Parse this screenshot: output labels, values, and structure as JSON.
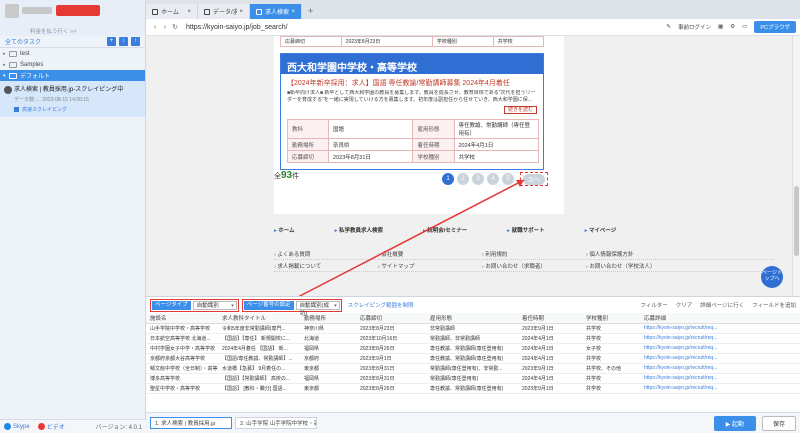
{
  "sidebar": {
    "promo": "料金を払う行く >>",
    "toolbar_title": "全てのタスク",
    "tree": [
      {
        "label": "test",
        "active": false
      },
      {
        "label": "Samples",
        "active": false
      },
      {
        "label": "デフォルト",
        "active": true
      }
    ],
    "task": {
      "title": "求人検索 | 教員採用.jp-スクレイピング中",
      "meta": "データ数: ... 2023-08-15 14:00:15",
      "status": "高速スクレイピング"
    },
    "footer": {
      "skype": "Skype",
      "video": "ビデオ",
      "version": "バージョン: 4.0.1"
    }
  },
  "browser": {
    "tabs": [
      {
        "label": "ホーム",
        "active": false
      },
      {
        "label": "データ/求...",
        "active": false
      },
      {
        "label": "求人検索 | ...",
        "active": true
      }
    ],
    "url": "https://kyoin-saiyo.jp/job_search/",
    "right": {
      "login": "事前ログイン",
      "pc": "PCブラウザ"
    }
  },
  "page": {
    "prev_rows": [
      {
        "k1": "応募締切",
        "v1": "2023年8月23日",
        "k2": "学校種別",
        "v2": "共学校"
      }
    ],
    "card": {
      "title": "西大和学園中学校・高等学校",
      "sub": "【2024年新卒採用：求人】国語 専任教諭/常勤講師募集 2024年4月着任",
      "desc": "■新卒向け求人■ 新卒として西大和学園の教員を募集します。教員を成長させ、教育目標である\"次代を担うリーダーを育成する\"を一緒に実現していける方を募集します。初年度は副担任から任せていき、西大和学園に保...",
      "more": "続きを読む",
      "rows": [
        {
          "k1": "教科",
          "v1": "国語",
          "k2": "雇用形態",
          "v2": "専任教諭、常勤講師（専任登用有）"
        },
        {
          "k1": "勤務場所",
          "v1": "奈良県",
          "k2": "着任時期",
          "v2": "2024年4月1日"
        },
        {
          "k1": "応募締切",
          "v1": "2023年8月31日",
          "k2": "学校種別",
          "v2": "共学校"
        }
      ]
    },
    "count_prefix": "全",
    "count": "93",
    "count_suffix": "件",
    "pages": [
      "1",
      "2",
      "3",
      "4",
      "5"
    ],
    "next": "次へ",
    "foot_nav": [
      "ホーム",
      "私学教員求人検索",
      "説明会/セミナー",
      "就職サポート",
      "マイページ"
    ],
    "foot_links": [
      [
        "よくある質問",
        "会社概要",
        "利用規約",
        "個人情報保護方針"
      ],
      [
        "求人掲載について",
        "サイトマップ",
        "お問い合わせ（求職者）",
        "お問い合わせ（学校法人）"
      ]
    ],
    "back_top": "ページトップへ"
  },
  "panel": {
    "page_type_label": "ページタイプ",
    "page_type_value": "自動識別",
    "paging_label": "ページ番号の設定",
    "paging_value": "自動識別(成功)",
    "clear": "スクレイピング範囲を制限",
    "tools": [
      "フィルター",
      "クリア",
      "詳細ページに行く",
      "フィールドを追加"
    ],
    "columns": [
      "施設名",
      "求人教科タイトル",
      "勤務場所",
      "応募締切",
      "雇用形態",
      "着任時期",
      "学校種別",
      "応募詳細"
    ],
    "rows": [
      [
        "山手学院中学校・高等学校",
        "令和5年度非常勤講師(専門...",
        "神奈川県",
        "2023年8月23日",
        "非常勤講師",
        "2023年9月1日",
        "共学校",
        "https://kyoin-saiyo.jp/recruit/req..."
      ],
      [
        "日本航空高等学校 北海道...",
        "【国語】【専任】 新規開校に...",
        "北海道",
        "2023年10月16日",
        "常勤講師、非常勤講師",
        "2024年4月1日",
        "共学校",
        "https://kyoin-saiyo.jp/recruit/req..."
      ],
      [
        "中村学園女子中学・高等学校",
        "2024年4月着任 【国語】 新...",
        "福岡県",
        "2023年8月26日",
        "専任教諭、常勤講師(専任登用有)",
        "2024年4月1日",
        "女子校",
        "https://kyoin-saiyo.jp/recruit/req..."
      ],
      [
        "京都府京都大谷高等学校",
        "【国語/専任教諭、常勤講師】...",
        "京都府",
        "2023年9月1日",
        "専任教諭、常勤講師(専任登用有)",
        "2024年4月1日",
        "共学校",
        "https://kyoin-saiyo.jp/recruit/req..."
      ],
      [
        "郁文館中学校（全日制）・高等...",
        "水道橋【急募】 9月着任の...",
        "東京都",
        "2023年8月31日",
        "常勤講師(専任登用有)、非常勤...",
        "2023年9月1日",
        "共学校、その他",
        "https://kyoin-saiyo.jp/recruit/req..."
      ],
      [
        "博多高等学校",
        "【国語】【常勤講師】 高校の...",
        "福岡県",
        "2023年8月31日",
        "常勤講師(専任登用有)",
        "2024年4月1日",
        "共学校",
        "https://kyoin-saiyo.jp/recruit/req..."
      ],
      [
        "聖星中学校・高等学校",
        "【国語】 [教科・職分] 国語...",
        "東京都",
        "2023年8月26日",
        "専任教諭、常勤講師(専任登用有)",
        "2023年9月1日",
        "共学校",
        "https://kyoin-saiyo.jp/recruit/req..."
      ]
    ]
  },
  "bottom_tabs": [
    "1. 求人検索 | 教員採用.jp",
    "2. 山手学院 山手学院中学校・高等..."
  ],
  "actions": {
    "run": "起動",
    "save": "保存"
  },
  "colors": {
    "accent": "#3b8fe8",
    "highlight": "#e53935",
    "card_title": "#2f6fd3"
  },
  "icons": {
    "next_arrow": "arrow-icon"
  }
}
